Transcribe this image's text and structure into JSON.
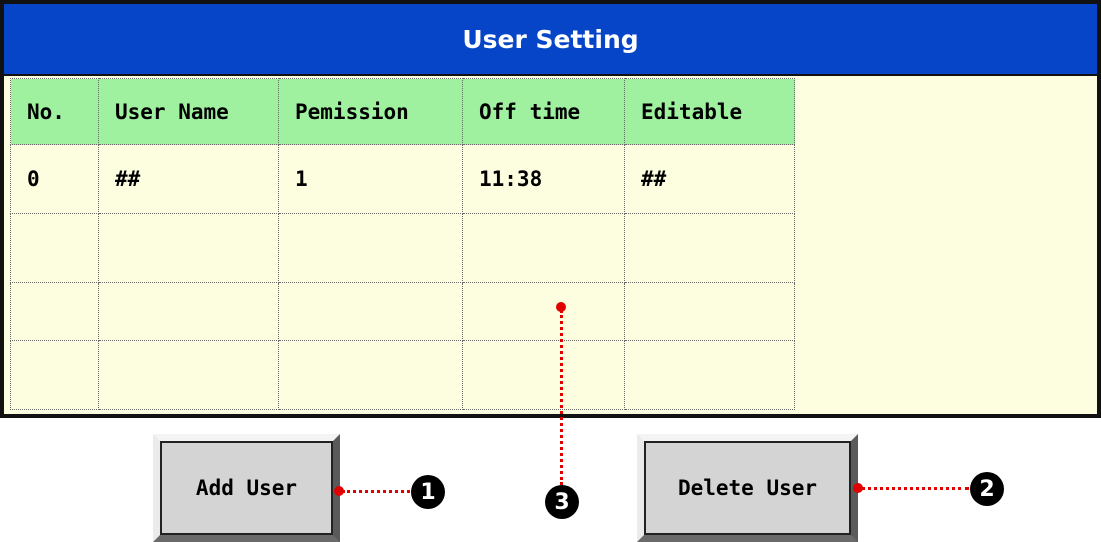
{
  "window": {
    "title": "User Setting"
  },
  "table": {
    "headers": [
      "No.",
      "User Name",
      "Pemission",
      "Off time",
      "Editable"
    ],
    "rows": [
      [
        "0",
        "##",
        "1",
        "11:38",
        "##"
      ],
      [
        "",
        "",
        "",
        "",
        ""
      ],
      [
        "",
        "",
        "",
        "",
        ""
      ],
      [
        "",
        "",
        "",
        "",
        ""
      ]
    ]
  },
  "buttons": {
    "add": "Add User",
    "delete": "Delete User"
  },
  "callouts": {
    "one": "1",
    "two": "2",
    "three": "3"
  },
  "colors": {
    "title_bar": "#0645c8",
    "header_row": "#9ff09f",
    "panel": "#fdfde0",
    "callout": "#e00000"
  }
}
